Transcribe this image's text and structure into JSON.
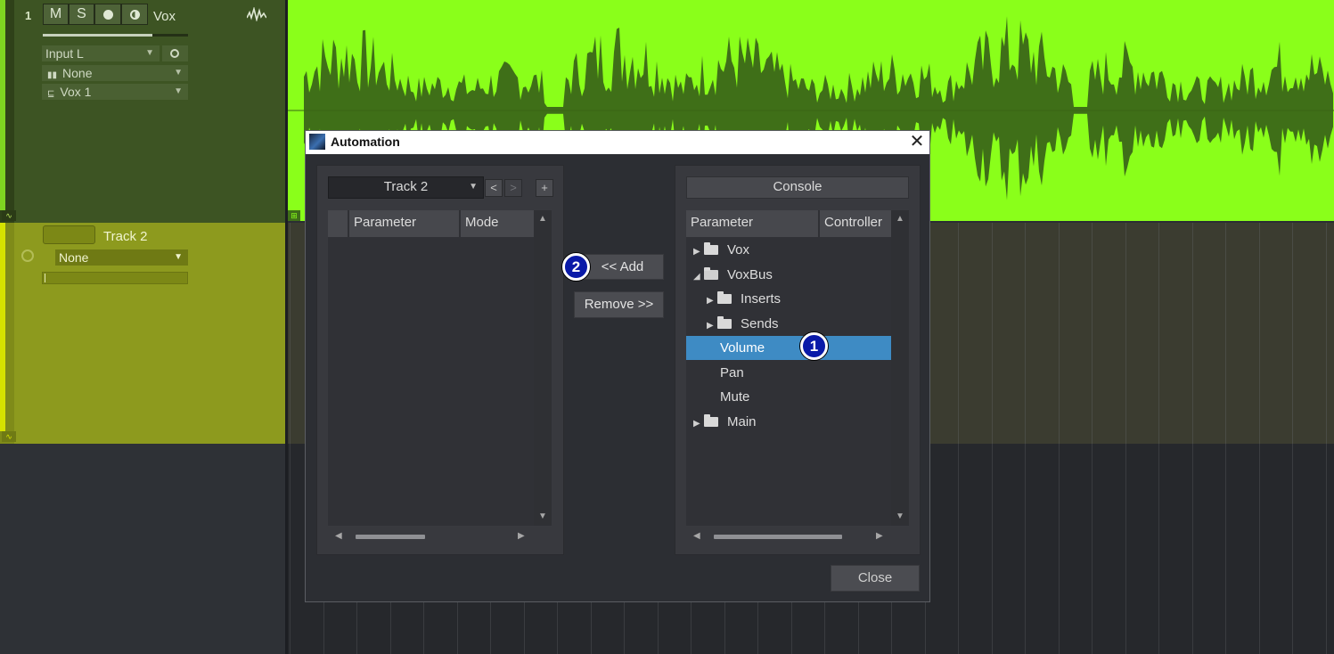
{
  "track1": {
    "number": "1",
    "mute": "M",
    "solo": "S",
    "name": "Vox",
    "input": "Input L",
    "insert": "None",
    "output": "Vox 1"
  },
  "track2": {
    "name": "Track 2",
    "selector": "None"
  },
  "dialog": {
    "title": "Automation",
    "close_x": "✕",
    "left": {
      "track_select": "Track 2",
      "prev": "<",
      "next": ">",
      "add": "+",
      "col_parameter": "Parameter",
      "col_mode": "Mode"
    },
    "add_button": "<< Add",
    "remove_button": "Remove >>",
    "right": {
      "source": "Console",
      "col_parameter": "Parameter",
      "col_controller": "Controller",
      "tree": [
        {
          "label": "Vox",
          "arrow": "▶"
        },
        {
          "label": "VoxBus",
          "arrow": "◢"
        },
        {
          "label": "Inserts",
          "arrow": "▶"
        },
        {
          "label": "Sends",
          "arrow": "▶"
        },
        {
          "label": "Volume",
          "selected": true
        },
        {
          "label": "Pan"
        },
        {
          "label": "Mute"
        },
        {
          "label": "Main",
          "arrow": "▶"
        }
      ]
    },
    "close_button": "Close"
  },
  "badges": {
    "one": "1",
    "two": "2"
  },
  "colors": {
    "waveform_bg": "#8aff1a",
    "waveform": "#3f6f18",
    "selection": "#3e8bc4",
    "badge": "#0a1aa8"
  }
}
